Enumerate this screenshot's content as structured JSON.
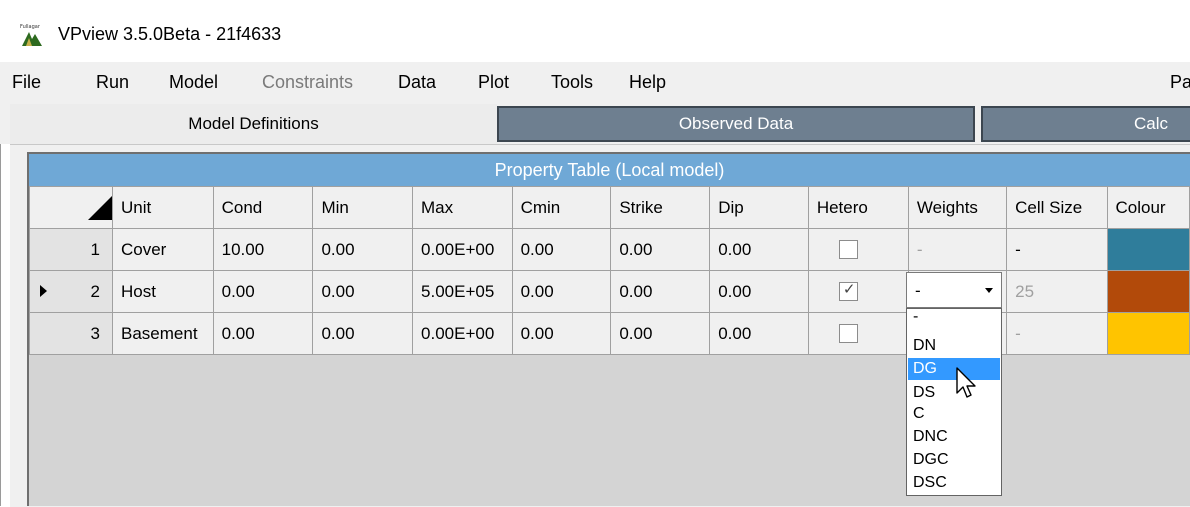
{
  "window": {
    "title": "VPview 3.5.0Beta - 21f4633",
    "icon": "app-logo-icon"
  },
  "menu": [
    {
      "label": "File",
      "enabled": true
    },
    {
      "label": "Run",
      "enabled": true
    },
    {
      "label": "Model",
      "enabled": true
    },
    {
      "label": "Constraints",
      "enabled": false
    },
    {
      "label": "Data",
      "enabled": true
    },
    {
      "label": "Plot",
      "enabled": true
    },
    {
      "label": "Tools",
      "enabled": true
    },
    {
      "label": "Help",
      "enabled": true
    },
    {
      "label": "Pa",
      "enabled": true
    }
  ],
  "tabs": [
    {
      "label": "Model Definitions",
      "active": true
    },
    {
      "label": "Observed Data",
      "active": false
    },
    {
      "label": "Calc",
      "active": false
    }
  ],
  "table": {
    "caption": "Property Table (Local model)",
    "columns": [
      "Unit",
      "Cond",
      "Min",
      "Max",
      "Cmin",
      "Strike",
      "Dip",
      "Hetero",
      "Weights",
      "Cell Size",
      "Colour"
    ],
    "rows": [
      {
        "num": "1",
        "unit": "Cover",
        "cond": "10.00",
        "min": "0.00",
        "max": "0.00E+00",
        "cmin": "0.00",
        "strike": "0.00",
        "dip": "0.00",
        "hetero": false,
        "weights": "-",
        "cell_size": "-",
        "colour": "#2f7d9b"
      },
      {
        "num": "2",
        "unit": "Host",
        "cond": "0.00",
        "min": "0.00",
        "max": "5.00E+05",
        "cmin": "0.00",
        "strike": "0.00",
        "dip": "0.00",
        "hetero": true,
        "weights": "-",
        "cell_size": "25",
        "colour": "#b24a0a",
        "current": true
      },
      {
        "num": "3",
        "unit": "Basement",
        "cond": "0.00",
        "min": "0.00",
        "max": "0.00E+00",
        "cmin": "0.00",
        "strike": "0.00",
        "dip": "0.00",
        "hetero": false,
        "weights": "-",
        "cell_size": "-",
        "colour": "#ffc400"
      }
    ]
  },
  "weights_dropdown": {
    "value": "-",
    "options": [
      "-",
      "DN",
      "DG",
      "DS",
      "C",
      "DNC",
      "DGC",
      "DSC"
    ],
    "highlighted": "DG"
  }
}
